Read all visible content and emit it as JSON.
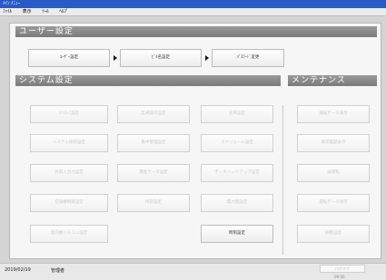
{
  "window": {
    "title": "ﾒｲﾝ ﾒﾆｭｰ"
  },
  "menu": [
    "ﾌｧｲﾙ",
    "表示",
    "ﾂｰﾙ",
    "ﾍﾙﾌﾟ"
  ],
  "user_section": {
    "title": "ユーザー設定",
    "buttons": [
      "ﾕｰｻﾞｰ設定",
      "ﾋﾞﾙ名設定",
      "ﾊﾟｽﾜｰﾄﾞ変更"
    ]
  },
  "system_section": {
    "title": "システム設定",
    "buttons": [
      [
        "ｺﾝﾄﾛｰﾗ設定",
        "監視操作設定",
        "名称設定"
      ],
      [
        "システム接続設定",
        "集中管理設定",
        "スケジュール設定"
      ],
      [
        "外部入出力設定",
        "課金データ設定",
        "データバックアップ設定"
      ],
      [
        "空調機制御設定",
        "時刻設定",
        "電力量設定"
      ],
      [
        "室内機リモコン設定",
        "",
        "時刻設定"
      ]
    ]
  },
  "maint_section": {
    "title": "メンテナンス",
    "buttons": [
      "運転データ表示",
      "異常履歴表示",
      "試運転",
      "運転データ保存",
      "調整設定"
    ]
  },
  "status": {
    "date": "2019/02/19",
    "user": "管理者",
    "button": "ログオフ",
    "time": "09:00"
  }
}
